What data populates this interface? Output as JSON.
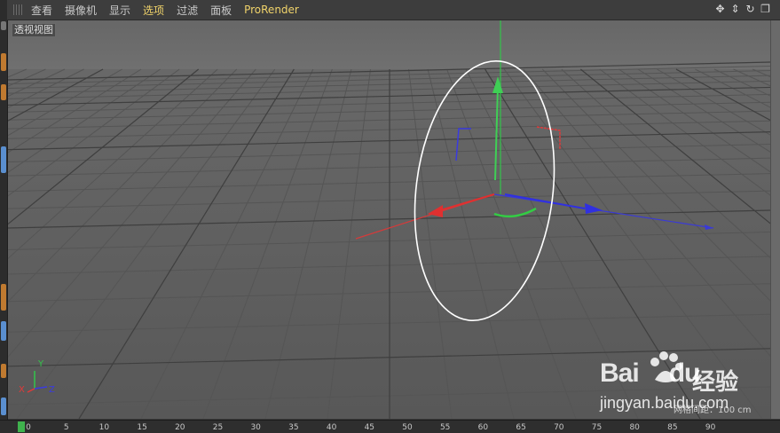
{
  "menubar": {
    "items": [
      {
        "label": "查看"
      },
      {
        "label": "摄像机"
      },
      {
        "label": "显示"
      },
      {
        "label": "选项"
      },
      {
        "label": "过滤"
      },
      {
        "label": "面板"
      },
      {
        "label": "ProRender"
      }
    ],
    "active_index": 3,
    "nav_icons": [
      "move-icon",
      "zoom-icon",
      "rotate-icon",
      "maximize-icon"
    ]
  },
  "viewport": {
    "label": "透视视图",
    "axis_indicator": {
      "y": "Y",
      "x": "X",
      "z": "Z"
    },
    "grid_spacing": "网格间距：100 cm",
    "zoom": "0.5"
  },
  "timeline": {
    "ticks": [
      "0",
      "5",
      "10",
      "15",
      "20",
      "25",
      "30",
      "35",
      "40",
      "45",
      "50",
      "55",
      "60",
      "65",
      "70",
      "75",
      "80",
      "85",
      "90"
    ]
  },
  "watermark": {
    "logo": "Bai",
    "logo_suffix": "du",
    "experience": "经验",
    "url": "jingyan.baidu.com"
  },
  "colors": {
    "x_axis": "#e03a3a",
    "y_axis": "#2ecc40",
    "z_axis": "#3040e0",
    "highlight": "#f0d36a"
  }
}
